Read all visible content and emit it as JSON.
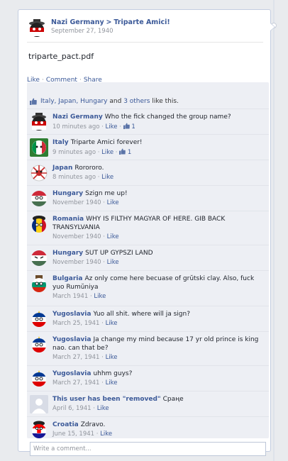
{
  "post": {
    "author": "Nazi Germany",
    "arrow": ">",
    "target": "Triparte Amici!",
    "date": "September 27, 1940",
    "body": "triparte_pact.pdf",
    "actions": [
      "Like",
      "Comment",
      "Share"
    ]
  },
  "likes": {
    "names": "Italy, Japan, Hungary",
    "and_text": "and",
    "others": "3 others",
    "suffix": "like this."
  },
  "comments": [
    {
      "name": "Nazi Germany",
      "text": "Who the fick changed the group name?",
      "time": "10 minutes ago",
      "like": "Like",
      "like_count": "1",
      "avatar": "nazi-germany-ball"
    },
    {
      "name": "Italy",
      "text": "Triparte Amici forever!",
      "time": "9 minutes ago",
      "like": "Like",
      "like_count": "1",
      "avatar": "italy-ball"
    },
    {
      "name": "Japan",
      "text": "Rorororo.",
      "time": "8 minutes ago",
      "like": "Like",
      "avatar": "japan-ball"
    },
    {
      "name": "Hungary",
      "text": "Szign me up!",
      "time": "November 1940",
      "like": "Like",
      "avatar": "hungary-ball"
    },
    {
      "name": "Romania",
      "text": "WHY IS FILTHY MAGYAR OF HERE. GIB BACK TRANSYLVANIA",
      "time": "November 1940",
      "like": "Like",
      "avatar": "romania-ball"
    },
    {
      "name": "Hungary",
      "text": "SUT UP GYPSZI LAND",
      "time": "November 1940",
      "like": "Like",
      "avatar": "hungary-ball"
    },
    {
      "name": "Bulgaria",
      "text": "Az only come here becuase of grŭtski clay. Also, fuck yuo Rumŭniya",
      "time": "March 1941",
      "like": "Like",
      "avatar": "bulgaria-ball"
    },
    {
      "name": "Yugoslavia",
      "text": "Yuo all shit. where will ja sign?",
      "time": "March 25, 1941",
      "like": "Like",
      "avatar": "yugoslavia-ball"
    },
    {
      "name": "Yugoslavia",
      "text": "Ja change my mind because 17 yr old prince is king nao. can that be?",
      "time": "March 27, 1941",
      "like": "Like",
      "avatar": "yugoslavia-ball"
    },
    {
      "name": "Yugoslavia",
      "text": "uhhm guys?",
      "time": "March 27, 1941",
      "like": "Like",
      "avatar": "yugoslavia-ball"
    },
    {
      "name": "This user has been \"removed\"",
      "text": "Сраңе",
      "time": "April 6, 1941",
      "like": "Like",
      "avatar": "default-avatar"
    },
    {
      "name": "Croatia",
      "text": "Zdravo.",
      "time": "June 15, 1941",
      "like": "Like",
      "avatar": "croatia-ball"
    }
  ],
  "write_comment": {
    "placeholder": "Write a comment..."
  }
}
